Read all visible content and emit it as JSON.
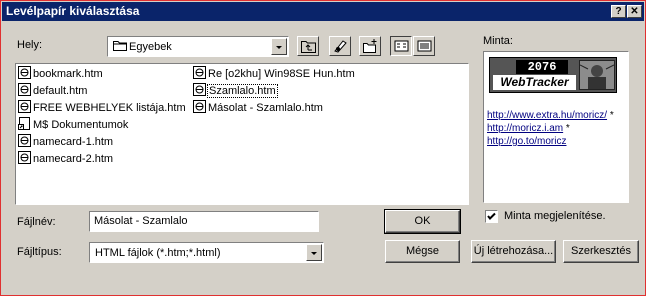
{
  "window": {
    "title": "Levélpapír kiválasztása"
  },
  "titlebar": {
    "help_label": "?",
    "close_label": "✕"
  },
  "location": {
    "label": "Hely:",
    "value": "Egyebek",
    "icon": "folder-icon"
  },
  "toolbar": {
    "up_icon": "up-folder-icon",
    "desktop_icon": "desktop-icon",
    "new_folder_icon": "new-folder-icon",
    "list_view_icon": "list-view-icon",
    "details_view_icon": "details-view-icon"
  },
  "files": [
    {
      "name": "bookmark.htm",
      "icon": "html-file-icon"
    },
    {
      "name": "default.htm",
      "icon": "html-file-icon"
    },
    {
      "name": "FREE WEBHELYEK listája.htm",
      "icon": "html-file-icon"
    },
    {
      "name": "M$ Dokumentumok",
      "icon": "shortcut-file-icon"
    },
    {
      "name": "namecard-1.htm",
      "icon": "html-file-icon"
    },
    {
      "name": "namecard-2.htm",
      "icon": "html-file-icon"
    },
    {
      "name": "Re [o2khu] Win98SE Hun.htm",
      "icon": "html-file-icon"
    },
    {
      "name": "Szamlalo.htm",
      "icon": "html-file-icon",
      "selected": true
    },
    {
      "name": "Másolat -  Szamlalo.htm",
      "icon": "html-file-icon"
    }
  ],
  "filename": {
    "label": "Fájlnév:",
    "value": "Másolat -  Szamlalo"
  },
  "filetype": {
    "label": "Fájltípus:",
    "value": "HTML fájlok (*.htm;*.html)"
  },
  "buttons": {
    "ok": "OK",
    "cancel": "Mégse",
    "new": "Új létrehozása...",
    "edit": "Szerkesztés"
  },
  "preview": {
    "label": "Minta:",
    "banner_number": "2076",
    "banner_text": "WebTracker",
    "links": [
      "http://www.extra.hu/moricz/",
      "http://moricz.i.am",
      "http://go.to/moricz"
    ],
    "link_suffixes": [
      " *",
      " *",
      ""
    ]
  },
  "show_preview": {
    "label": "Minta megjelenítése.",
    "checked": true
  }
}
